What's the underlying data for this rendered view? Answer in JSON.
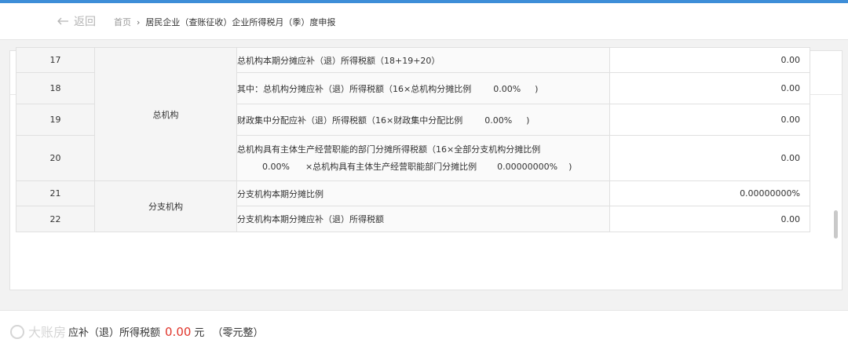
{
  "header": {
    "back_label": "返回",
    "breadcrumb_home": "首页",
    "breadcrumb_current": "居民企业（查账征收）企业所得税月（季）度申报"
  },
  "table": {
    "groups": {
      "head_office": "总机构",
      "branch": "分支机构"
    },
    "rows": [
      {
        "no": "17",
        "desc": "总机构本期分摊应补（退）所得税额（18+19+20）",
        "value": "0.00"
      },
      {
        "no": "18",
        "desc": "其中：总机构分摊应补（退）所得税额（16×总机构分摊比例",
        "pct": "0.00%",
        "tail": ")",
        "value": "0.00"
      },
      {
        "no": "19",
        "desc": "财政集中分配应补（退）所得税额（16×财政集中分配比例",
        "pct": "0.00%",
        "tail": ")",
        "value": "0.00"
      },
      {
        "no": "20",
        "desc": "总机构具有主体生产经营职能的部门分摊所得税额（16×全部分支机构分摊比例",
        "pct": "0.00%",
        "desc2": "×总机构具有主体生产经营职能部门分摊比例",
        "pct2": "0.00000000%",
        "tail": ")",
        "value": "0.00"
      },
      {
        "no": "21",
        "desc": "分支机构本期分摊比例",
        "value": "0.00000000%"
      },
      {
        "no": "22",
        "desc": "分支机构本期分摊应补（退）所得税额",
        "value": "0.00"
      }
    ]
  },
  "footer": {
    "label": "应补（退）所得税额",
    "amount": "0.00",
    "unit": "元",
    "amount_cn": "（零元整）",
    "watermark": "大账房"
  },
  "colors": {
    "accent": "#3e8ed8",
    "amount": "#e0362c"
  }
}
